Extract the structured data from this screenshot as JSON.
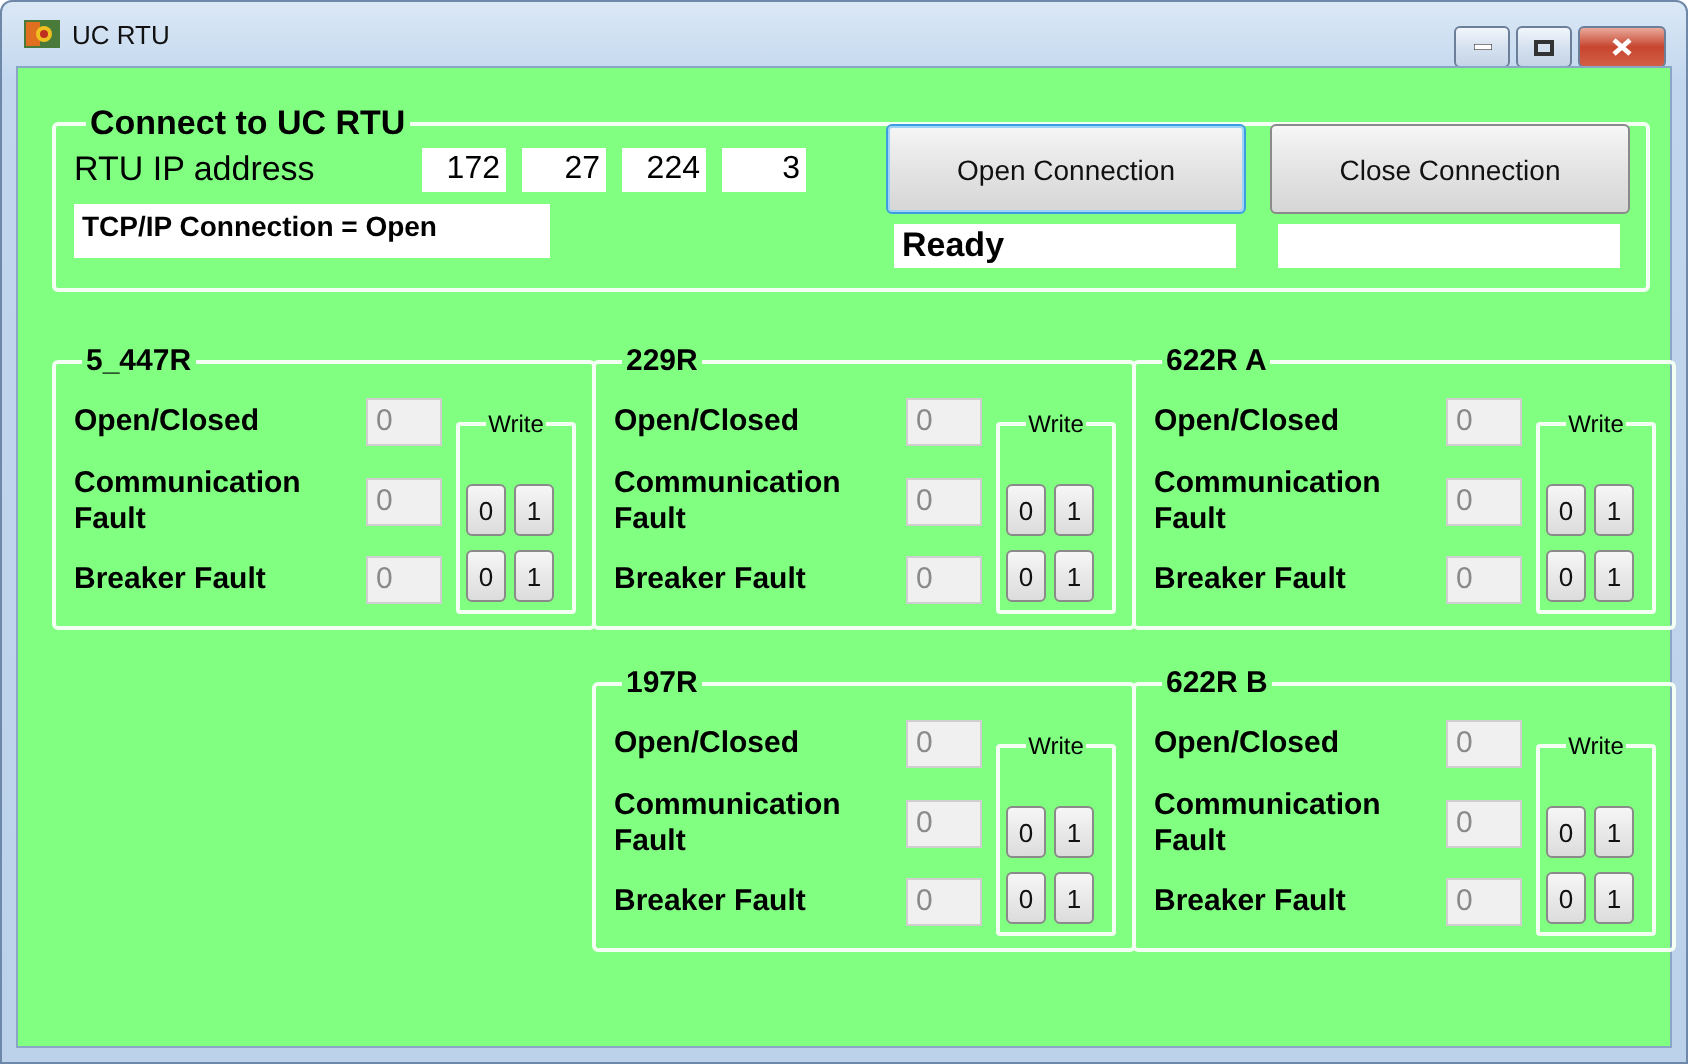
{
  "window": {
    "title": "UC RTU"
  },
  "connection": {
    "title": "Connect to UC RTU",
    "ip_label": "RTU IP address",
    "ip_octets": [
      "172",
      "27",
      "224",
      "3"
    ],
    "status_text": "TCP/IP Connection = Open",
    "buttons": [
      {
        "label": "Open Connection",
        "focused": true
      },
      {
        "label": "Close Connection",
        "focused": false
      }
    ],
    "status_fields": [
      "Ready"
    ]
  },
  "rtus": [
    {
      "name": "5_447R",
      "write_label": "Write",
      "rows": [
        {
          "label": "Open/Closed",
          "value": "0"
        },
        {
          "label": "Communication Fault",
          "value": "0",
          "buttons": [
            "0",
            "1"
          ]
        },
        {
          "label": "Breaker Fault",
          "value": "0",
          "buttons": [
            "0",
            "1"
          ]
        }
      ]
    },
    {
      "name": "229R",
      "write_label": "Write",
      "rows": [
        {
          "label": "Open/Closed",
          "value": "0"
        },
        {
          "label": "Communication Fault",
          "value": "0",
          "buttons": [
            "0",
            "1"
          ]
        },
        {
          "label": "Breaker Fault",
          "value": "0",
          "buttons": [
            "0",
            "1"
          ]
        }
      ]
    },
    {
      "name": "622R A",
      "write_label": "Write",
      "rows": [
        {
          "label": "Open/Closed",
          "value": "0"
        },
        {
          "label": "Communication Fault",
          "value": "0",
          "buttons": [
            "0",
            "1"
          ]
        },
        {
          "label": "Breaker Fault",
          "value": "0",
          "buttons": [
            "0",
            "1"
          ]
        }
      ]
    },
    {
      "name": "197R",
      "write_label": "Write",
      "rows": [
        {
          "label": "Open/Closed",
          "value": "0"
        },
        {
          "label": "Communication Fault",
          "value": "0",
          "buttons": [
            "0",
            "1"
          ]
        },
        {
          "label": "Breaker Fault",
          "value": "0",
          "buttons": [
            "0",
            "1"
          ]
        }
      ]
    },
    {
      "name": "622R B",
      "write_label": "Write",
      "rows": [
        {
          "label": "Open/Closed",
          "value": "0"
        },
        {
          "label": "Communication Fault",
          "value": "0",
          "buttons": [
            "0",
            "1"
          ]
        },
        {
          "label": "Breaker Fault",
          "value": "0",
          "buttons": [
            "0",
            "1"
          ]
        }
      ]
    }
  ]
}
